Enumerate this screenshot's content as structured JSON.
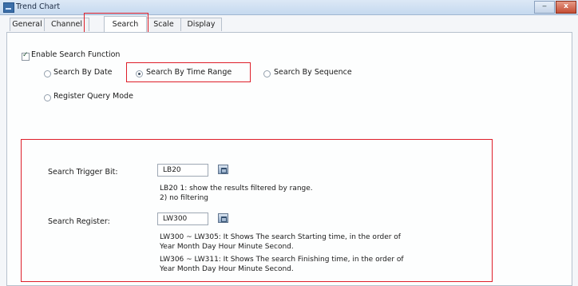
{
  "window": {
    "title": "Trend Chart",
    "min_label": "‒",
    "close_label": "x"
  },
  "tabs": [
    {
      "label": "General"
    },
    {
      "label": "Channel"
    },
    {
      "label": "Search"
    },
    {
      "label": "Scale"
    },
    {
      "label": "Display"
    }
  ],
  "search": {
    "enable_label": "Enable Search Function",
    "by_date_label": "Search By Date",
    "by_time_range_label": "Search By Time Range",
    "by_sequence_label": "Search By Sequence",
    "register_query_label": "Register Query Mode",
    "trigger_bit_label": "Search Trigger Bit:",
    "trigger_bit_value": "LB20",
    "trigger_bit_desc_1": "LB20 1: show the results filtered by range.",
    "trigger_bit_desc_2": "2) no filtering",
    "register_label": "Search Register:",
    "register_value": "LW300",
    "register_desc_1": "LW300 ~ LW305: It Shows The search Starting time, in the order of",
    "register_desc_2": "Year Month Day Hour Minute Second.",
    "register_desc_3": "LW306 ~ LW311: It Shows The search Finishing time, in the order of",
    "register_desc_4": "Year Month Day Hour Minute Second."
  },
  "colors": {
    "highlight": "#de1f2a"
  }
}
